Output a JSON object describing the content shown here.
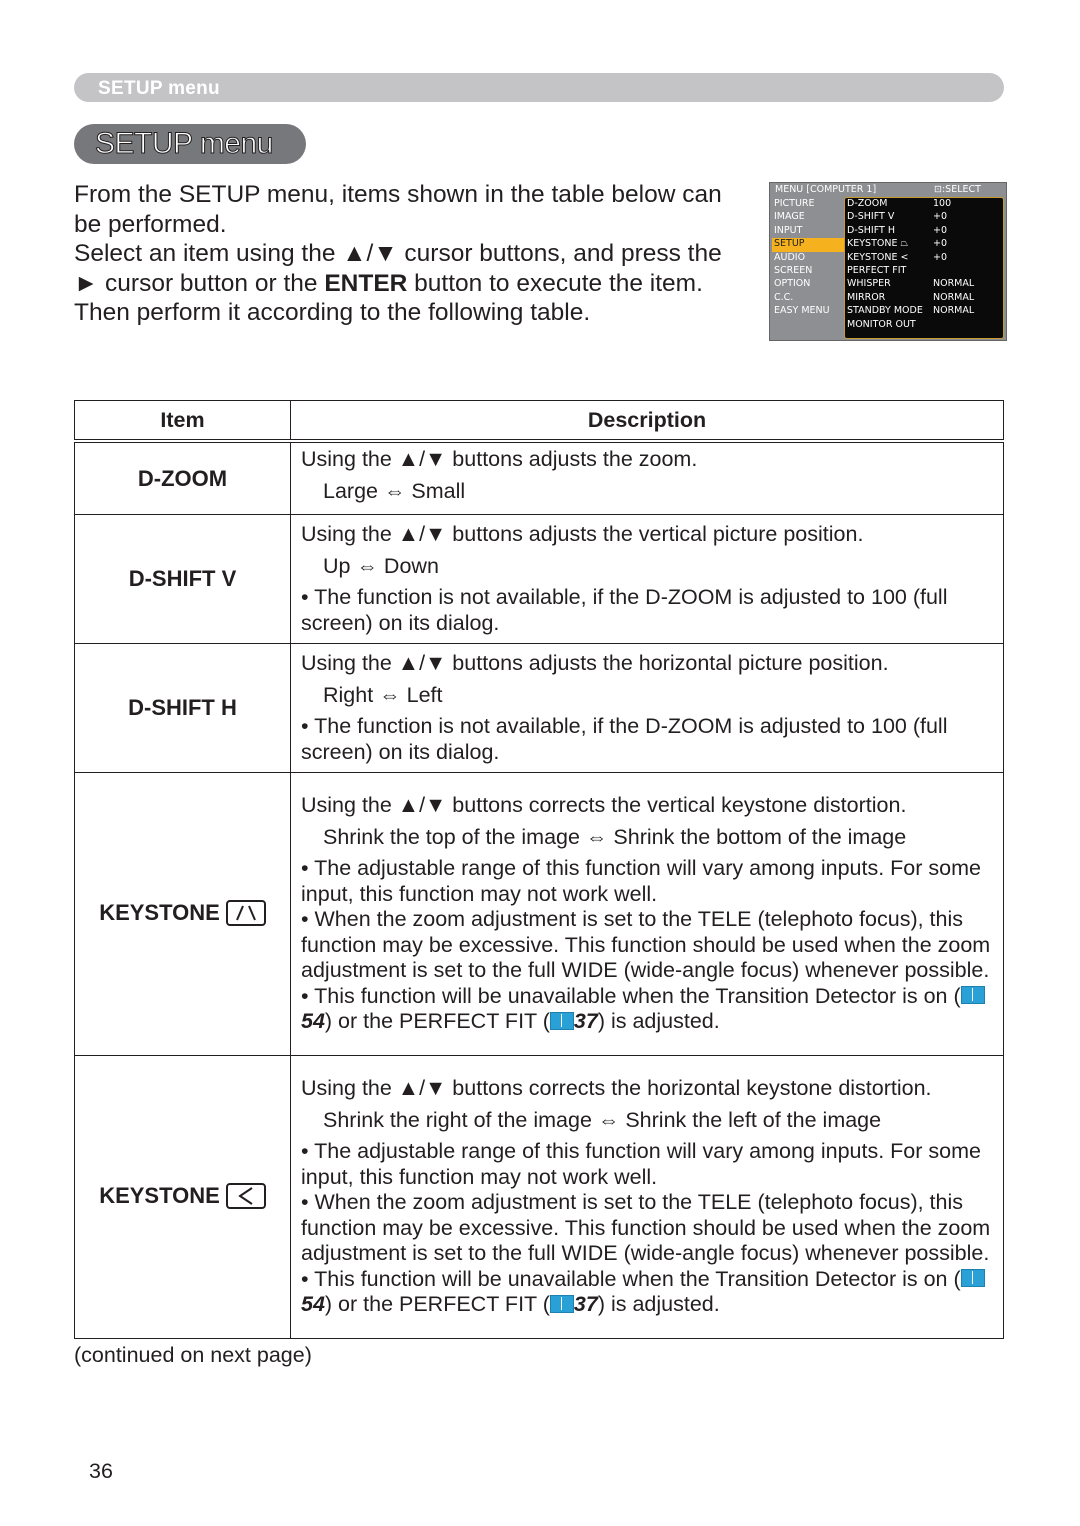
{
  "header": {
    "section_label": "SETUP menu",
    "title": "SETUP menu"
  },
  "intro": {
    "line1": "From the SETUP menu, items shown in the table below can be performed.",
    "line2_a": "Select an item using the ▲/▼ cursor buttons, and press the ► cursor button or the ",
    "line2_bold": "ENTER",
    "line2_b": " button to execute the item. Then perform it according to the following table."
  },
  "menu_screenshot": {
    "title": "MENU [COMPUTER 1]",
    "select_hint": "⊡:SELECT",
    "categories": [
      "PICTURE",
      "IMAGE",
      "INPUT",
      "SETUP",
      "AUDIO",
      "SCREEN",
      "OPTION",
      "C.C.",
      "EASY MENU"
    ],
    "selected_category": "SETUP",
    "items": [
      {
        "name": "D-ZOOM",
        "value": "100"
      },
      {
        "name": "D-SHIFT V",
        "value": "+0"
      },
      {
        "name": "D-SHIFT H",
        "value": "+0"
      },
      {
        "name": "KEYSTONE ⏢",
        "value": "+0"
      },
      {
        "name": "KEYSTONE <",
        "value": "+0"
      },
      {
        "name": "PERFECT FIT",
        "value": ""
      },
      {
        "name": "WHISPER",
        "value": "NORMAL"
      },
      {
        "name": "MIRROR",
        "value": "NORMAL"
      },
      {
        "name": "STANDBY MODE",
        "value": "NORMAL"
      },
      {
        "name": "MONITOR OUT",
        "value": ""
      }
    ]
  },
  "table": {
    "headers": {
      "item": "Item",
      "description": "Description"
    },
    "rows": [
      {
        "item": "D-ZOOM",
        "intro": "Using the ▲/▼ buttons adjusts the zoom.",
        "range": "Large ⇔ Small",
        "bullets": []
      },
      {
        "item": "D-SHIFT V",
        "intro": "Using the ▲/▼ buttons adjusts the vertical picture position.",
        "range": "Up ⇔ Down",
        "bullets": [
          "• The function is not available, if the D-ZOOM is adjusted to 100 (full screen) on its dialog."
        ]
      },
      {
        "item": "D-SHIFT H",
        "intro": "Using the ▲/▼ buttons adjusts the horizontal picture position.",
        "range": "Right ⇔ Left",
        "bullets": [
          "• The function is not available, if the D-ZOOM is adjusted to 100 (full screen) on its dialog."
        ]
      },
      {
        "item": "KEYSTONE",
        "icon": "vertical-keystone-icon",
        "intro": "Using the ▲/▼ buttons corrects the vertical keystone distortion.",
        "range": "Shrink the top of the image ⇔ Shrink the bottom of the image",
        "bullets": [
          "• The adjustable range of this function will vary among inputs. For some input, this function may not work well.",
          "• When the zoom adjustment is set to the TELE (telephoto focus), this function may be excessive. This function should be used when the zoom adjustment is set to the full WIDE (wide-angle focus) whenever possible."
        ],
        "last_a": "• This function will be unavailable when the Transition Detector is on (",
        "ref1": "54",
        "last_b": ") or the PERFECT FIT (",
        "ref2": "37",
        "last_c": ") is adjusted."
      },
      {
        "item": "KEYSTONE",
        "icon": "horizontal-keystone-icon",
        "intro": "Using the ▲/▼ buttons corrects the horizontal keystone distortion.",
        "range": "Shrink the right of the image ⇔ Shrink the left of the image",
        "bullets": [
          "• The adjustable range of this function will vary among inputs. For some input, this function may not work well.",
          "• When the zoom adjustment is set to the TELE (telephoto focus), this function may be excessive. This function should be used when the zoom adjustment is set to the full WIDE (wide-angle focus) whenever possible."
        ],
        "last_a": "• This function will be unavailable when the Transition Detector is on (",
        "ref1": "54",
        "last_b": ") or the PERFECT FIT (",
        "ref2": "37",
        "last_c": ") is adjusted."
      }
    ]
  },
  "footer": {
    "continued": "(continued on next page)",
    "page_number": "36"
  }
}
